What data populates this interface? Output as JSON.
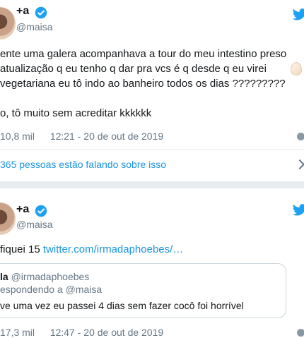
{
  "tweets": [
    {
      "author_name": "+a",
      "author_handle": "@maisa",
      "text_lines": [
        "ente uma galera acompanhava a tour do meu intestino preso",
        " atualização q eu tenho q dar pra vcs é q desde q eu virei",
        "vegetariana eu tô indo ao banheiro todos os dias ?????????",
        "",
        "o, tô muito sem acreditar kkkkkk"
      ],
      "likes": "10,8 mil",
      "timestamp": "12:21 - 20 de out de 2019",
      "conversation": "365 pessoas estão falando sobre isso"
    },
    {
      "author_name": "+a",
      "author_handle": "@maisa",
      "text_prefix": "fiquei 15 ",
      "link_text": "twitter.com/irmadaphoebes/…",
      "quoted": {
        "name": "la",
        "handle": "@irmadaphoebes",
        "reply_to": "espondendo a @maisa",
        "text": "ve uma vez eu passei 4 dias sem fazer cocô foi horrível"
      },
      "likes": "17,3 mil",
      "timestamp": "12:47 - 20 de out de 2019"
    }
  ],
  "colors": {
    "verified": "#1da1f2",
    "link": "#1b95e0",
    "muted": "#657786"
  },
  "icons": [
    "twitter-bird-icon",
    "verified-badge-icon",
    "heart-icon",
    "info-icon",
    "chevron-right-icon",
    "egg-emoji-icon"
  ]
}
